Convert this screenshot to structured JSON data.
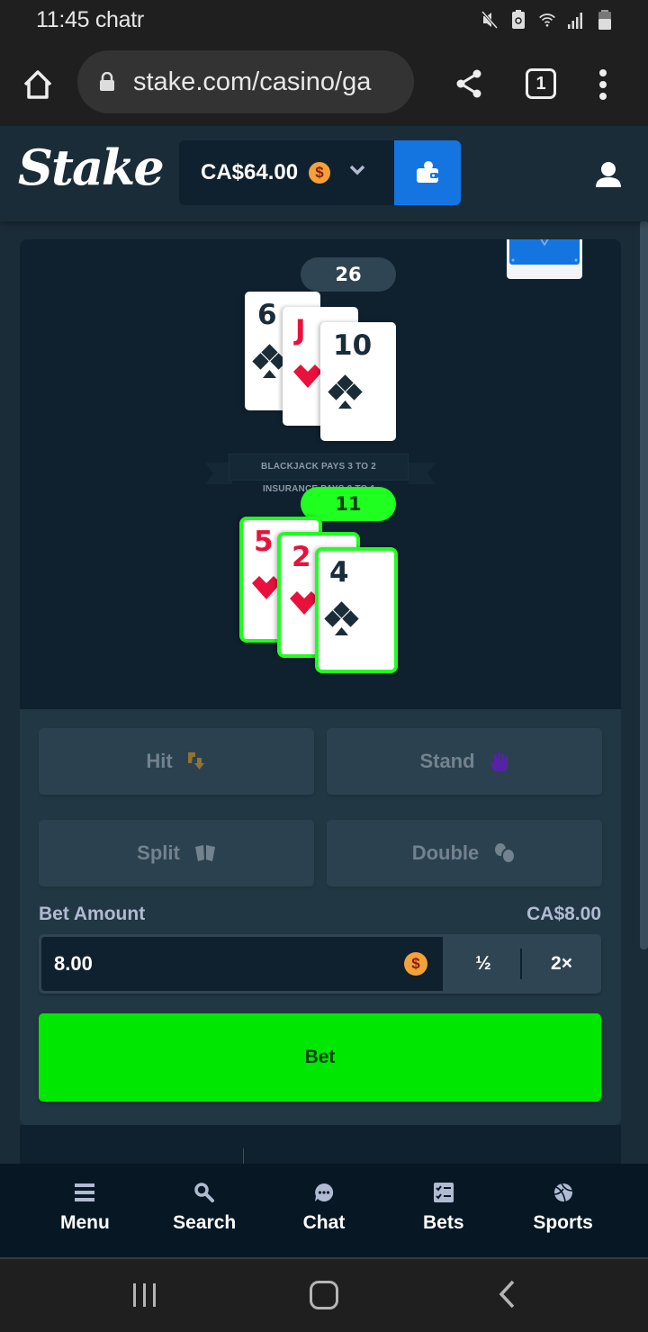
{
  "status_bar": {
    "time_carrier": "11:45 chatr",
    "icons": [
      "mute-icon",
      "battery-saver-icon",
      "wifi-icon",
      "signal-icon",
      "battery-icon"
    ]
  },
  "browser": {
    "url": "stake.com/casino/ga",
    "tab_count": "1",
    "icons": [
      "home-icon",
      "lock-icon",
      "share-icon",
      "tabs-icon",
      "more-vertical-icon"
    ]
  },
  "header": {
    "logo": "Stake",
    "balance": "CA$64.00",
    "currency_symbol": "$",
    "icons": [
      "coin-icon",
      "chevron-down-icon",
      "wallet-icon",
      "user-icon"
    ]
  },
  "game": {
    "dealer": {
      "score": "26",
      "cards": [
        {
          "rank": "6",
          "suit": "clubs",
          "color": "black"
        },
        {
          "rank": "J",
          "suit": "hearts",
          "color": "red"
        },
        {
          "rank": "10",
          "suit": "clubs",
          "color": "black"
        }
      ]
    },
    "player": {
      "score": "11",
      "cards": [
        {
          "rank": "5",
          "suit": "hearts",
          "color": "red"
        },
        {
          "rank": "2",
          "suit": "hearts",
          "color": "red"
        },
        {
          "rank": "4",
          "suit": "clubs",
          "color": "black"
        }
      ]
    },
    "table_text": {
      "blackjack_pays": "BLACKJACK PAYS 3 TO 2",
      "insurance": "INSURANCE PAYS 2 TO 1"
    },
    "actions": {
      "hit": "Hit",
      "stand": "Stand",
      "split": "Split",
      "double": "Double"
    },
    "bet": {
      "label": "Bet Amount",
      "converted": "CA$8.00",
      "value": "8.00",
      "currency_symbol": "$",
      "half_label": "½",
      "double_label": "2×",
      "bet_button": "Bet"
    }
  },
  "bottom_nav": [
    {
      "label": "Menu",
      "icon": "menu-icon"
    },
    {
      "label": "Search",
      "icon": "search-icon"
    },
    {
      "label": "Chat",
      "icon": "chat-icon"
    },
    {
      "label": "Bets",
      "icon": "bets-icon"
    },
    {
      "label": "Sports",
      "icon": "sports-icon"
    }
  ],
  "colors": {
    "background": "#1a2c38",
    "table": "#0f212e",
    "panel": "#213743",
    "button": "#2f4553",
    "bet_green": "#00e701",
    "win_green": "#1fff20",
    "wallet_blue": "#1475e1",
    "card_red": "#e9113c",
    "card_black": "#1a2c38",
    "hit_icon": "#b8862b",
    "stand_icon": "#6a1cc8"
  }
}
